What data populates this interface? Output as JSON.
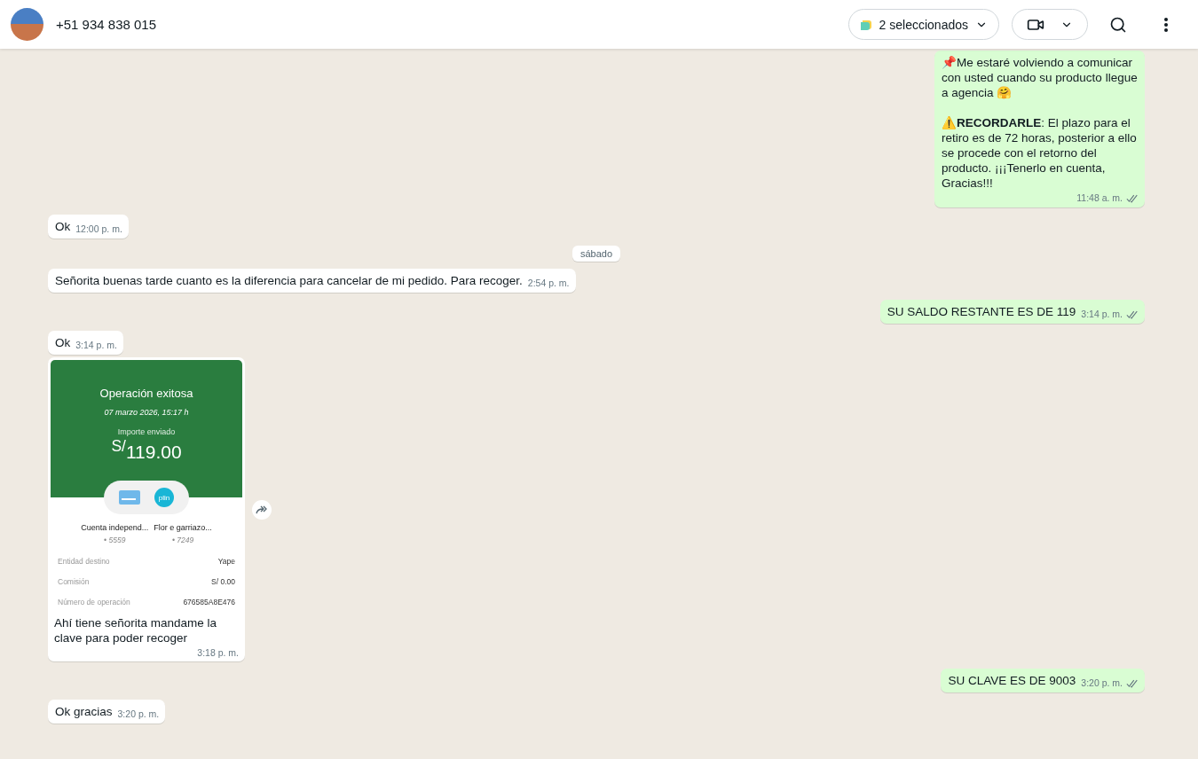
{
  "header": {
    "contact": "+51 934 838 015",
    "label_button": "2 seleccionados"
  },
  "messages": [
    {
      "kind": "text",
      "outgoing": true,
      "text": "📌Me estaré volviendo a comunicar con usted cuando su producto llegue a agencia 🤗\n\n⚠️**RECORDARLE**: El plazo para el retiro es de 72 horas, posterior a ello se procede con el retorno del producto. ¡¡¡Tenerlo en cuenta, Gracias!!!",
      "time": "11:48 a. m."
    },
    {
      "kind": "text",
      "outgoing": false,
      "text": "Ok",
      "time": "12:00 p. m."
    },
    {
      "kind": "date",
      "text": "sábado"
    },
    {
      "kind": "text",
      "outgoing": false,
      "text": "Señorita buenas tarde cuanto es la diferencia para cancelar de mi pedido. Para recoger.",
      "time": "2:54 p. m."
    },
    {
      "kind": "text",
      "outgoing": true,
      "text": "SU SALDO RESTANTE ES DE 119",
      "time": "3:14 p. m."
    },
    {
      "kind": "text",
      "outgoing": false,
      "text": "Ok",
      "time": "3:14 p. m."
    },
    {
      "kind": "image",
      "outgoing": false,
      "caption": "Ahí tiene señorita mandame la clave para poder recoger",
      "time": "3:18 p. m.",
      "receipt": {
        "title": "Operación exitosa",
        "date": "07 marzo 2026,  15:17 h",
        "amount_label": "Importe enviado",
        "currency": "S/",
        "amount": "119.00",
        "logo_text": "plin",
        "accounts": [
          {
            "name": "Cuenta independ...",
            "number": "• 5559"
          },
          {
            "name": "Flor e garriazo...",
            "number": "• 7249"
          }
        ],
        "details": [
          {
            "label": "Entidad destino",
            "value": "Yape"
          },
          {
            "label": "Comisión",
            "value": "S/ 0.00"
          },
          {
            "label": "Número de operación",
            "value": "676585A8E476"
          }
        ]
      }
    },
    {
      "kind": "text",
      "outgoing": true,
      "text": "SU CLAVE ES DE 9003",
      "time": "3:20 p. m."
    },
    {
      "kind": "text",
      "outgoing": false,
      "text": "Ok gracias",
      "time": "3:20 p. m."
    }
  ]
}
